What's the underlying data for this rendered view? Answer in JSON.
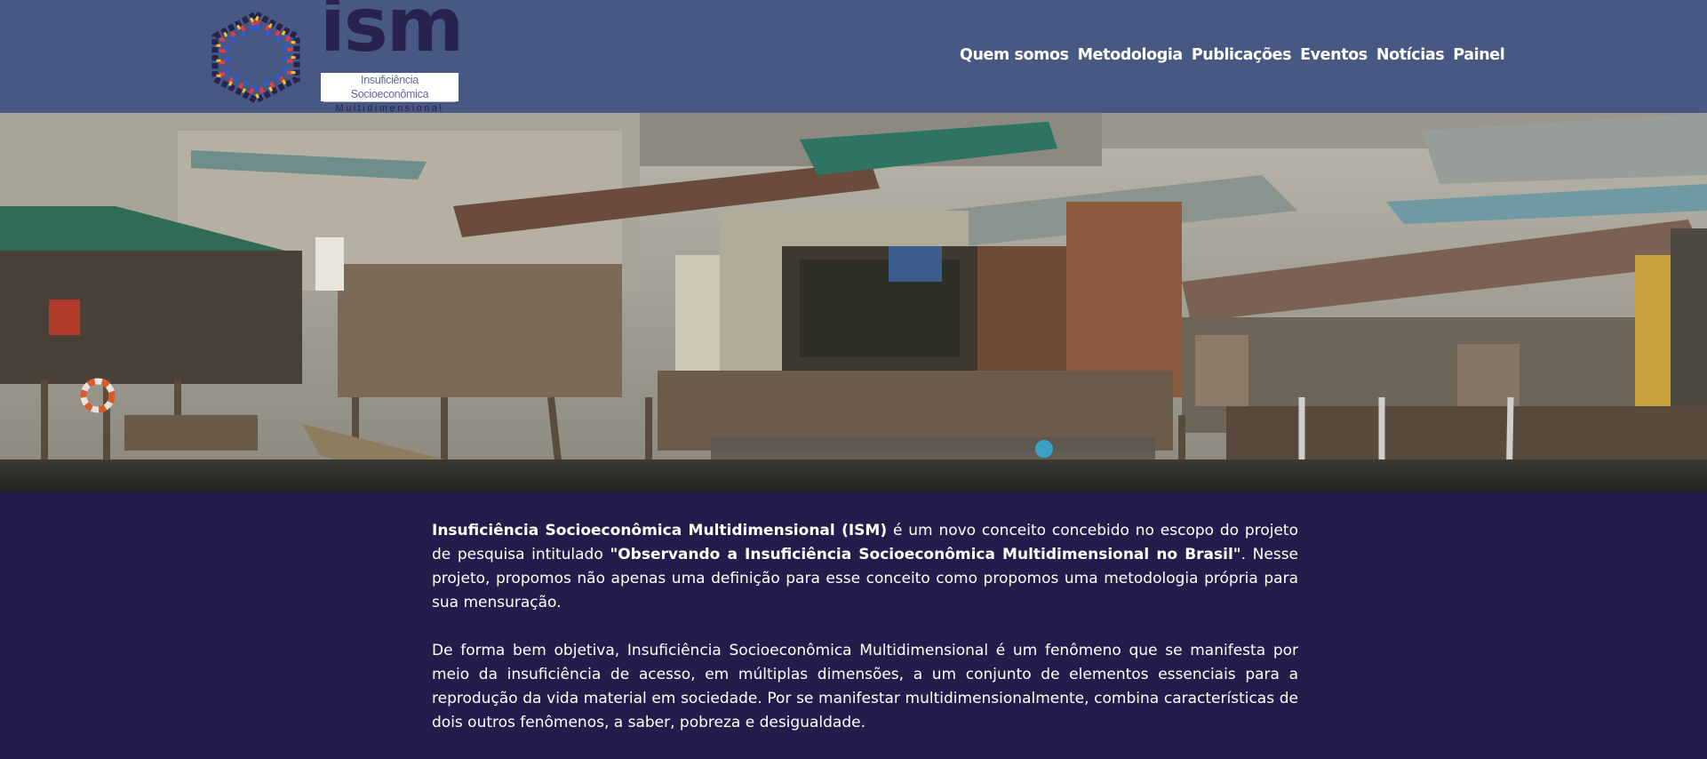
{
  "logo": {
    "wordmark": "ism",
    "tagline_line1": "Insuficiência Socioeconômica",
    "tagline_line2": "Multidimensional"
  },
  "nav": {
    "items": [
      {
        "label": "Quem somos"
      },
      {
        "label": "Metodologia"
      },
      {
        "label": "Publicações"
      },
      {
        "label": "Eventos"
      },
      {
        "label": "Notícias"
      },
      {
        "label": "Painel"
      }
    ]
  },
  "colors": {
    "header_bg": "#475882",
    "body_bg": "#231d4b",
    "logo_dark": "#28224f"
  },
  "intro": {
    "p1_bold_term": "Insuficiência Socioeconômica Multidimensional (ISM)",
    "p1_text_a": " é um novo conceito concebido no escopo do projeto de pesquisa intitulado ",
    "p1_project": "\"Observando a Insuficiência Socioeconômica Multidimensional no Brasil\"",
    "p1_text_b": ". Nesse projeto, propomos não apenas uma definição para esse conceito como propomos uma metodologia própria para sua mensuração.",
    "p2": "De forma bem objetiva, Insuficiência Socioeconômica Multidimensional é um fenômeno que se manifesta por meio da insuficiência de acesso, em múltiplas dimensões, a um conjunto de elementos essenciais para a reprodução da vida material em sociedade. Por se manifestar multidimensionalmente, combina características de dois outros fenômenos, a saber, pobreza e desigualdade."
  }
}
